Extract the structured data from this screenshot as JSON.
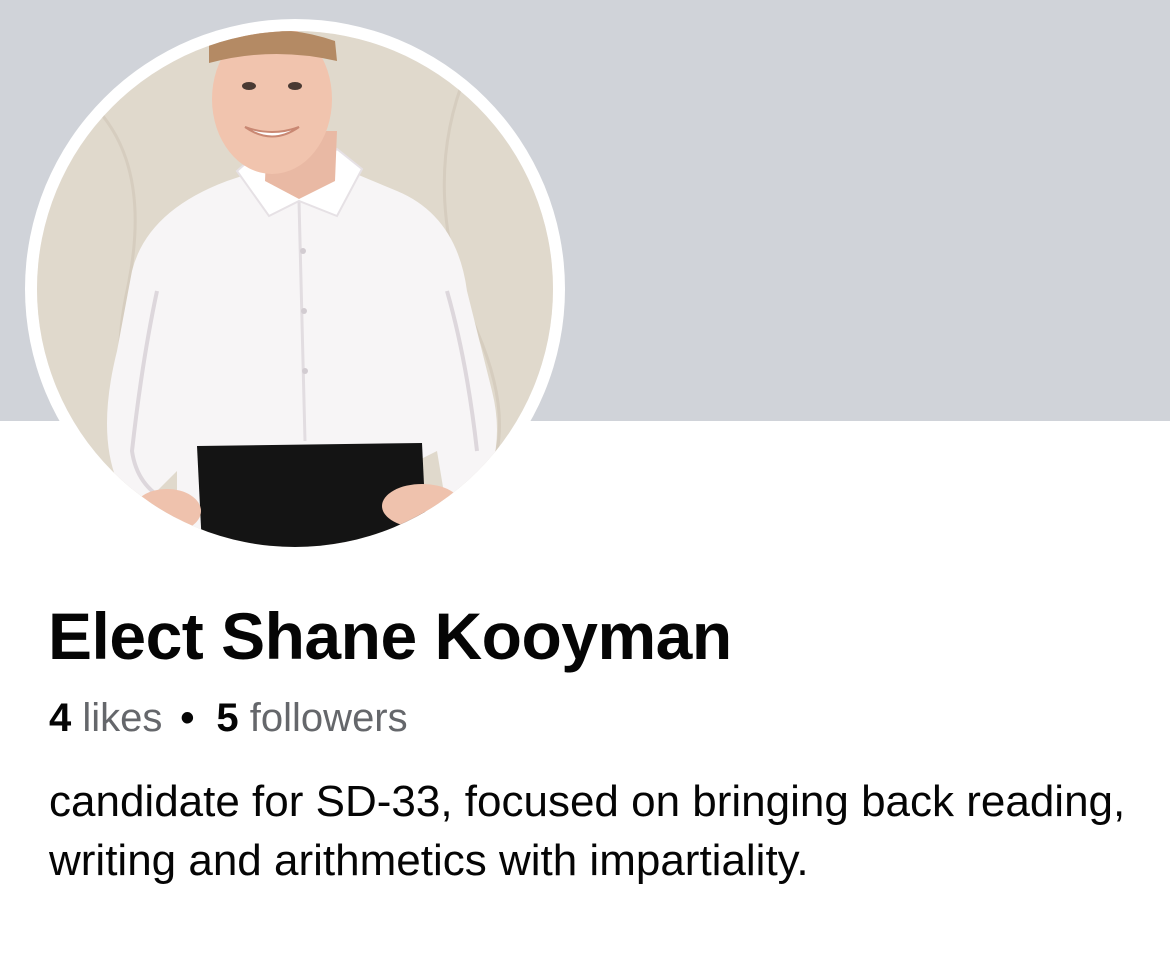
{
  "profile": {
    "name": "Elect Shane Kooyman",
    "likes_count": "4",
    "likes_label": "likes",
    "separator": "•",
    "followers_count": "5",
    "followers_label": "followers",
    "bio": "candidate for SD-33, focused on bringing back reading, writing and arithmetics with impartiality."
  },
  "colors": {
    "cover_background": "#d0d3d9",
    "secondary_text": "#65676b",
    "primary_text": "#050505"
  }
}
